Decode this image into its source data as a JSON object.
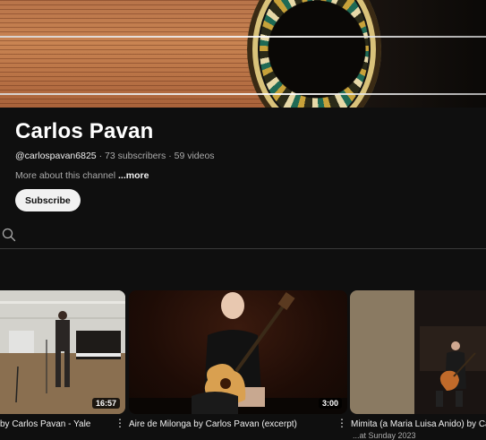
{
  "channel": {
    "name": "Carlos Pavan",
    "handle": "@carlospavan6825",
    "subscribers": "73 subscribers",
    "videos": "59 videos",
    "about": "More about this channel",
    "more": "...more",
    "subscribe_label": "Subscribe"
  },
  "videos": [
    {
      "title": "by Carlos Pavan - Yale",
      "duration": "16:57"
    },
    {
      "title": "Aire de Milonga by Carlos Pavan (excerpt)",
      "duration": "3:00"
    },
    {
      "title": "Mimita (a Maria Luisa Anido) by Ca",
      "subline": "...at Sunday 2023"
    }
  ],
  "icons": {
    "search": "search-icon",
    "kebab": "more-vert-icon"
  }
}
